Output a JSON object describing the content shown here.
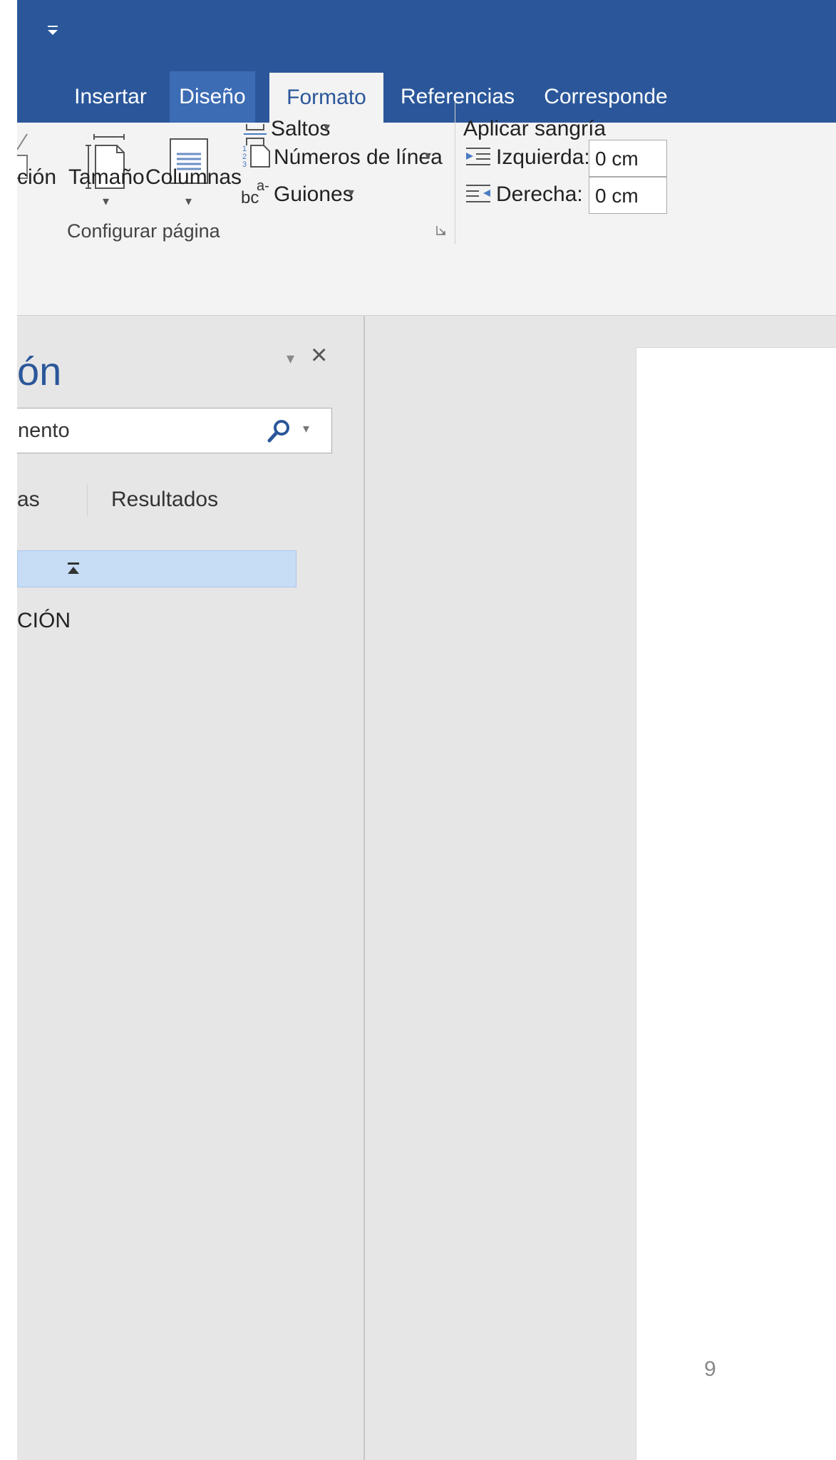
{
  "title_bar": {
    "qat_customize_icon": "qat-customize-icon"
  },
  "tabs": [
    {
      "label": "Insertar"
    },
    {
      "label": "Diseño"
    },
    {
      "label": "Formato"
    },
    {
      "label": "Referencias"
    },
    {
      "label": "Corresponde"
    }
  ],
  "ribbon": {
    "page_setup": {
      "orientation_label": "ción",
      "size_label": "Tamaño",
      "columns_label": "Columnas",
      "breaks_label": "Saltos",
      "line_numbers_label": "Números de línea",
      "hyphenation_label": "Guiones",
      "hyphenation_icon_text": "bc",
      "hyphenation_icon_sup": "a-",
      "group_label": "Configurar página"
    },
    "indent": {
      "title": "Aplicar sangría",
      "left_label": "Izquierda:",
      "left_value": "0 cm",
      "right_label": "Derecha:",
      "right_value": "0 cm"
    }
  },
  "nav_pane": {
    "title": "ón",
    "search_placeholder": "nento",
    "tab_pages": "as",
    "tab_results": "Resultados",
    "heading_item": "CIÓN"
  },
  "document": {
    "page_number": "9"
  },
  "colors": {
    "accent": "#2b579a",
    "ribbon_bg": "#f3f3f3",
    "canvas_bg": "#e6e6e6",
    "selection": "#c7ddf5"
  }
}
